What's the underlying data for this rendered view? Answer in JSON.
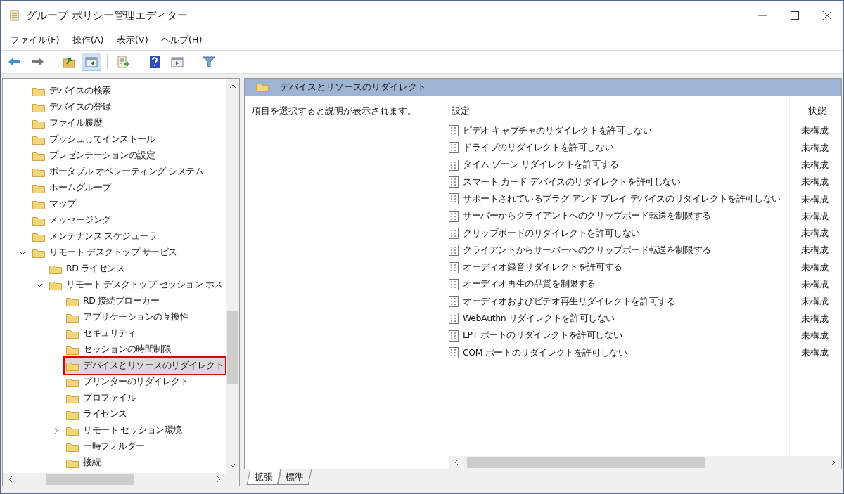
{
  "window": {
    "title": "グループ ポリシー管理エディター"
  },
  "menu": [
    "ファイル(F)",
    "操作(A)",
    "表示(V)",
    "ヘルプ(H)"
  ],
  "toolbar": [
    {
      "kind": "back"
    },
    {
      "kind": "forward"
    },
    {
      "kind": "sep"
    },
    {
      "kind": "up",
      "selected": false
    },
    {
      "kind": "pane",
      "selected": true
    },
    {
      "kind": "sep"
    },
    {
      "kind": "export",
      "selected": false
    },
    {
      "kind": "sep"
    },
    {
      "kind": "help",
      "selected": false
    },
    {
      "kind": "pane2",
      "selected": false
    },
    {
      "kind": "sep"
    },
    {
      "kind": "filter",
      "selected": false
    }
  ],
  "tree": [
    {
      "label": "デバイスの検索",
      "selected": false
    },
    {
      "label": "デバイスの登録",
      "selected": false
    },
    {
      "label": "ファイル履歴",
      "selected": false
    },
    {
      "label": "プッシュしてインストール",
      "selected": false
    },
    {
      "label": "プレゼンテーションの設定",
      "selected": false
    },
    {
      "label": "ポータブル オペレーティング システム",
      "selected": false
    },
    {
      "label": "ホームグループ",
      "selected": false
    },
    {
      "label": "マップ",
      "selected": false
    },
    {
      "label": "メッセージング",
      "selected": false
    },
    {
      "label": "メンテナンス スケジューラ",
      "selected": false
    },
    {
      "label": "リモート デスクトップ サービス",
      "selected": false,
      "expanded": true,
      "children": [
        {
          "label": "RD ライセンス",
          "selected": false
        },
        {
          "label": "リモート デスクトップ セッション ホス",
          "selected": false,
          "expanded": true,
          "children": [
            {
              "label": "RD 接続ブローカー",
              "selected": false
            },
            {
              "label": "アプリケーションの互換性",
              "selected": false
            },
            {
              "label": "セキュリティ",
              "selected": false
            },
            {
              "label": "セッションの時間制限",
              "selected": false
            },
            {
              "label": "デバイスとリソースのリダイレクト",
              "selected": true
            },
            {
              "label": "プリンターのリダイレクト",
              "selected": false
            },
            {
              "label": "プロファイル",
              "selected": false
            },
            {
              "label": "ライセンス",
              "selected": false
            },
            {
              "label": "リモート セッション環境",
              "selected": false,
              "expanded": false
            },
            {
              "label": "一時フォルダー",
              "selected": false
            },
            {
              "label": "接続",
              "selected": false
            }
          ]
        }
      ]
    }
  ],
  "detail": {
    "title": "デバイスとリソースのリダイレクト",
    "description": "項目を選択すると説明が表示されます。",
    "columns": [
      "設定",
      "状態"
    ],
    "rows": [
      {
        "setting": "ビデオ キャプチャのリダイレクトを許可しない",
        "state": "未構成"
      },
      {
        "setting": "ドライブのリダイレクトを許可しない",
        "state": "未構成"
      },
      {
        "setting": "タイム ゾーン リダイレクトを許可する",
        "state": "未構成"
      },
      {
        "setting": "スマート カード デバイスのリダイレクトを許可しない",
        "state": "未構成"
      },
      {
        "setting": "サポートされているプラグ アンド プレイ デバイスのリダイレクトを許可しない",
        "state": "未構成"
      },
      {
        "setting": "サーバーからクライアントへのクリップボード転送を制限する",
        "state": "未構成"
      },
      {
        "setting": "クリップボードのリダイレクトを許可しない",
        "state": "未構成"
      },
      {
        "setting": "クライアントからサーバーへのクリップボード転送を制限する",
        "state": "未構成"
      },
      {
        "setting": "オーディオ録音リダイレクトを許可する",
        "state": "未構成"
      },
      {
        "setting": "オーディオ再生の品質を制限する",
        "state": "未構成"
      },
      {
        "setting": "オーディオおよびビデオ再生リダイレクトを許可する",
        "state": "未構成"
      },
      {
        "setting": "WebAuthn リダイレクトを許可しない",
        "state": "未構成"
      },
      {
        "setting": "LPT ポートのリダイレクトを許可しない",
        "state": "未構成"
      },
      {
        "setting": "COM ポートのリダイレクトを許可しない",
        "state": "未構成"
      }
    ]
  },
  "tabs": [
    {
      "label": "拡張",
      "selected": true
    },
    {
      "label": "標準",
      "selected": false
    }
  ]
}
